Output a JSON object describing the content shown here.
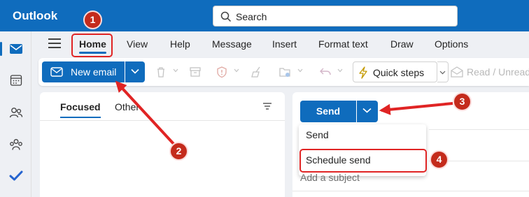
{
  "app": {
    "title": "Outlook"
  },
  "search": {
    "placeholder": "Search"
  },
  "menu": {
    "tabs": [
      "Home",
      "View",
      "Help",
      "Message",
      "Insert",
      "Format text",
      "Draw",
      "Options"
    ],
    "active": "Home"
  },
  "ribbon": {
    "new_email_label": "New email",
    "quick_steps_label": "Quick steps",
    "read_unread_label": "Read / Unread"
  },
  "list": {
    "tabs": [
      "Focused",
      "Other"
    ]
  },
  "compose": {
    "send_label": "Send",
    "send_menu_items": [
      "Send",
      "Schedule send"
    ],
    "subject_placeholder": "Add a subject"
  },
  "annotations": {
    "badges": [
      "1",
      "2",
      "3",
      "4"
    ]
  },
  "colors": {
    "accent": "#0f6cbd",
    "annotation": "#e02424",
    "badge_fill": "#c42b1c"
  },
  "icons": [
    "search-icon",
    "mail-icon",
    "calendar-icon",
    "people-icon",
    "groups-icon",
    "todo-icon",
    "hamburger-icon",
    "delete-icon",
    "archive-icon",
    "report-icon",
    "sweep-icon",
    "move-icon",
    "undo-icon",
    "lightning-icon",
    "envelope-open-icon",
    "filter-icon",
    "chevron-down-icon"
  ]
}
